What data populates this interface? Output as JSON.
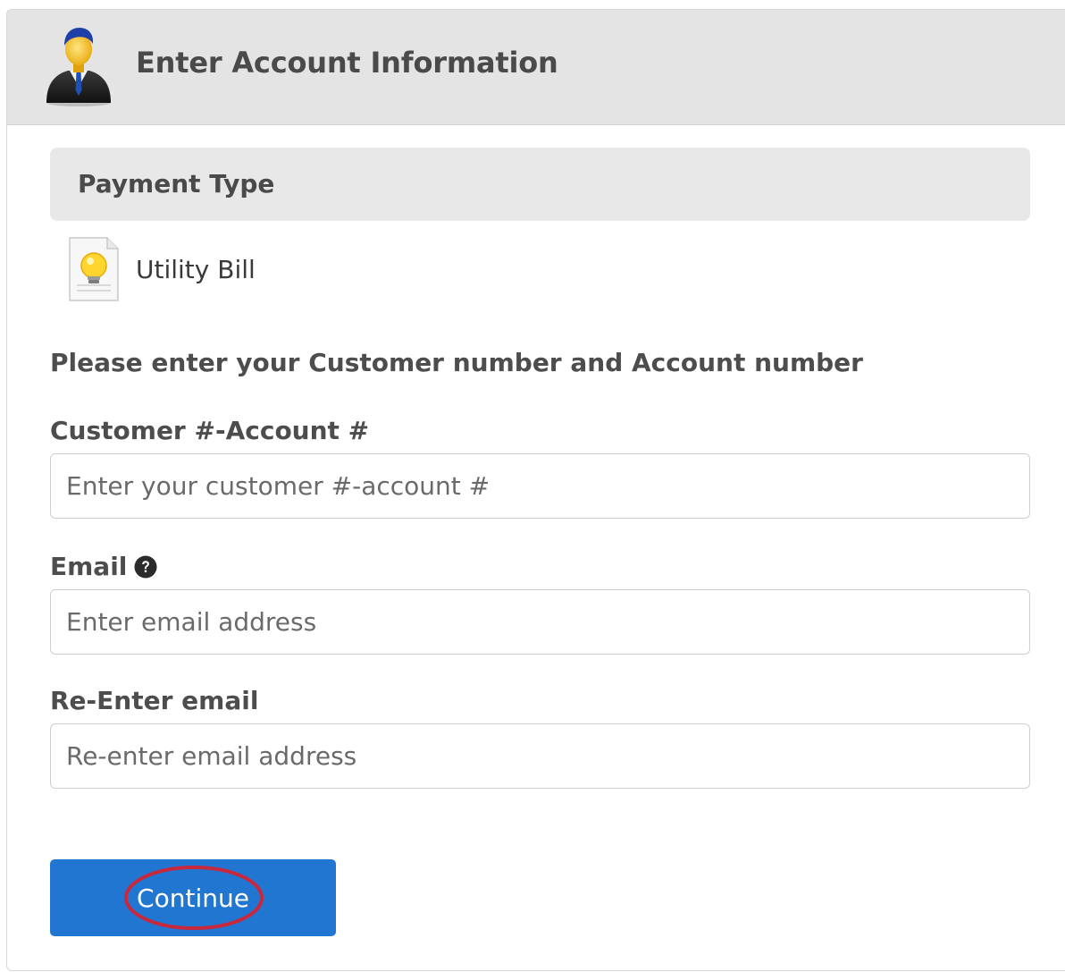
{
  "header": {
    "title": "Enter Account Information",
    "avatar_icon": "businessman-icon"
  },
  "payment_type": {
    "section_label": "Payment Type",
    "option_label": "Utility Bill",
    "option_icon": "lightbulb-document-icon"
  },
  "form": {
    "instructions": "Please enter your Customer number and Account number",
    "customer_account": {
      "label": "Customer #-Account #",
      "placeholder": "Enter your customer #-account #",
      "value": ""
    },
    "email": {
      "label": "Email",
      "placeholder": "Enter email address",
      "value": "",
      "help_icon": "question-circle-icon"
    },
    "reenter_email": {
      "label": "Re-Enter email",
      "placeholder": "Re-enter email address",
      "value": ""
    },
    "continue_label": "Continue"
  },
  "colors": {
    "primary_button": "#2176d2",
    "highlight_ring": "#c8283c",
    "header_bg": "#e4e4e4"
  }
}
